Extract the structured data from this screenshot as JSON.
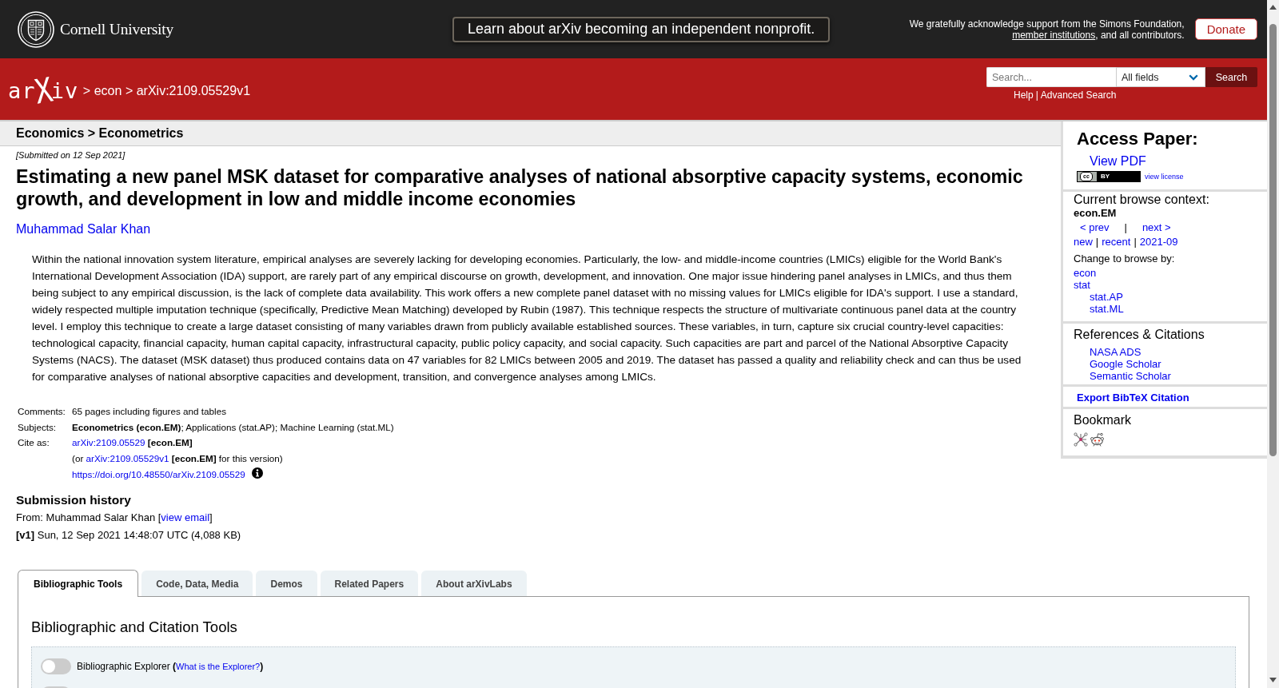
{
  "top_bar": {
    "university": "Cornell University",
    "announcement": "Learn about arXiv becoming an independent nonprofit.",
    "acknowledgment": {
      "before": "We gratefully acknowledge support from the Simons Foundation,",
      "link": "member institutions",
      "after": ", and all contributors."
    },
    "donate": "Donate"
  },
  "header": {
    "logo": "arXiv",
    "breadcrumb": [
      {
        "separator": ">",
        "label": "econ"
      },
      {
        "separator": ">",
        "label": "arXiv:2109.05529v1"
      }
    ],
    "search": {
      "placeholder": "Search...",
      "field": "All fields",
      "button": "Search",
      "links": [
        "Help",
        "Advanced Search"
      ],
      "links_separator": "|"
    }
  },
  "category_header": "Economics > Econometrics",
  "paper": {
    "submitted": "[Submitted on 12 Sep 2021]",
    "title": "Estimating a new panel MSK dataset for comparative analyses of national absorptive capacity systems, economic growth, and development in low and middle income economies",
    "authors": [
      "Muhammad Salar Khan"
    ],
    "abstract": "Within the national innovation system literature, empirical analyses are severely lacking for developing economies. Particularly, the low- and middle-income countries (LMICs) eligible for the World Bank's International Development Association (IDA) support, are rarely part of any empirical discourse on growth, development, and innovation. One major issue hindering panel analyses in LMICs, and thus them being subject to any empirical discussion, is the lack of complete data availability. This work offers a new complete panel dataset with no missing values for LMICs eligible for IDA's support. I use a standard, widely respected multiple imputation technique (specifically, Predictive Mean Matching) developed by Rubin (1987). This technique respects the structure of multivariate continuous panel data at the country level. I employ this technique to create a large dataset consisting of many variables drawn from publicly available established sources. These variables, in turn, capture six crucial country-level capacities: technological capacity, financial capacity, human capital capacity, infrastructural capacity, public policy capacity, and social capacity. Such capacities are part and parcel of the National Absorptive Capacity Systems (NACS). The dataset (MSK dataset) thus produced contains data on 47 variables for 82 LMICs between 2005 and 2019. The dataset has passed a quality and reliability check and can thus be used for comparative analyses of national absorptive capacities and development, transition, and convergence analyses among LMICs.",
    "metadata": [
      {
        "kind": "text",
        "label": "Comments:",
        "value": "65 pages including figures and tables"
      },
      {
        "kind": "text",
        "label": "Subjects:",
        "value": "**Econometrics (econ.EM)**; Applications (stat.AP); Machine Learning (stat.ML)"
      },
      {
        "kind": "cite",
        "label": "Cite as:",
        "lines": [
          {
            "link": "arXiv:2109.05529",
            "tag": "[econ.EM]"
          },
          {
            "before": "(or",
            "link": "arXiv:2109.05529v1",
            "tag": "[econ.EM]",
            "after": "for this version)"
          },
          {
            "link": "https://doi.org/10.48550/arXiv.2109.05529",
            "info": true
          }
        ]
      }
    ]
  },
  "sidebar": {
    "access": {
      "heading": "Access Paper:",
      "links": [
        "View PDF"
      ],
      "license": {
        "cc": "cc",
        "by": "BY",
        "link": "view license"
      }
    },
    "browse": {
      "heading": "Current browse context:",
      "context": "econ.EM",
      "nav": [
        {
          "label": "< prev"
        },
        {
          "separator": "|",
          "label": "next >"
        }
      ],
      "periods": [
        {
          "label": "new"
        },
        {
          "separator": "|",
          "label": "recent"
        },
        {
          "separator": "|",
          "label": "2021-09"
        }
      ],
      "change_label": "Change to browse by:",
      "categories": [
        {
          "label": "econ"
        },
        {
          "label": "stat",
          "children": [
            {
              "label": "stat.AP"
            },
            {
              "label": "stat.ML"
            }
          ]
        }
      ]
    },
    "references": {
      "heading": "References & Citations",
      "links": [
        "NASA ADS",
        "Google Scholar",
        "Semantic Scholar"
      ]
    },
    "export": "Export BibTeX Citation",
    "bookmark": {
      "heading": "Bookmark"
    }
  },
  "history": {
    "heading": "Submission history",
    "from": {
      "before": "From: Muhammad Salar Khan [",
      "link": "view email",
      "after": "]"
    },
    "versions": [
      "**[v1]** Sun, 12 Sep 2021 14:48:07 UTC (4,088 KB)"
    ]
  },
  "tabs": [
    {
      "label": "Bibliographic Tools",
      "selected": true
    },
    {
      "label": "Code, Data, Media",
      "selected": false
    },
    {
      "label": "Demos",
      "selected": false
    },
    {
      "label": "Related Papers",
      "selected": false
    },
    {
      "label": "About arXivLabs",
      "selected": false
    }
  ],
  "tools": {
    "heading": "Bibliographic and Citation Tools",
    "toggles": [
      {
        "label": "Bibliographic Explorer",
        "before_link": "(",
        "link": "What is the Explorer?",
        "after_link": ")",
        "on": false
      },
      {
        "on": false
      }
    ]
  }
}
